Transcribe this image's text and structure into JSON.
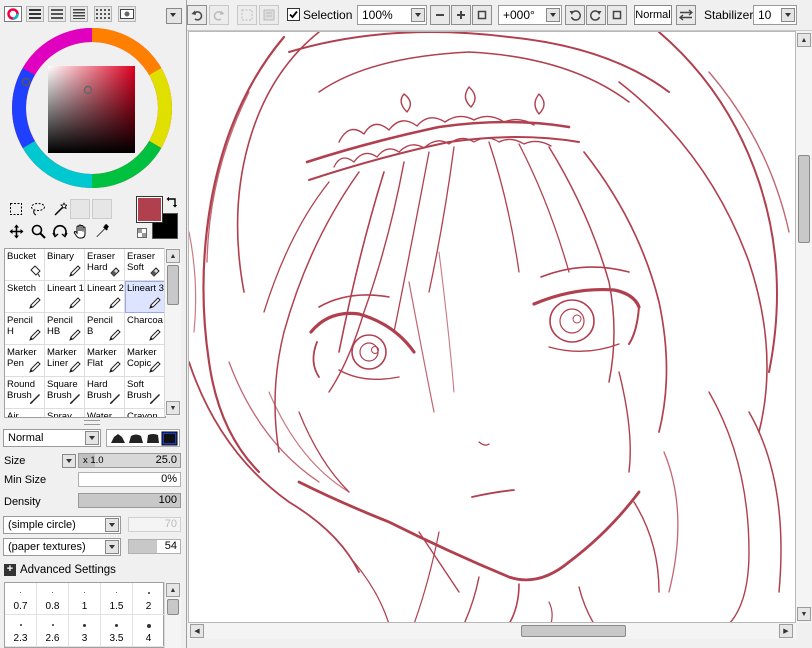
{
  "left_panel": {
    "color_mode_tabs": [
      "color-wheel-icon",
      "rgb-slider-icon",
      "hsv-slider-icon",
      "palette-icon",
      "swatch-icon",
      "scratch-pad-icon"
    ],
    "colors": {
      "primary": "#b0404d",
      "secondary": "#000000",
      "hue_ring_marker": "#d23c6a",
      "canvas_line": "#b1404f"
    },
    "tools": [
      "rectangle-select-icon",
      "lasso-icon",
      "magic-wand-icon",
      "move-icon",
      "zoom-icon",
      "rotate-icon",
      "hand-icon",
      "eyedropper-icon"
    ],
    "brushes": [
      [
        "Bucket",
        "Binary",
        "Eraser\nHard",
        "Eraser\nSoft"
      ],
      [
        "Sketch",
        "Lineart 1",
        "Lineart 2",
        "Lineart 3"
      ],
      [
        "Pencil\nH",
        "Pencil\nHB",
        "Pencil\nB",
        "Charcoa"
      ],
      [
        "Marker\nPen",
        "Marker\nLiner",
        "Marker\nFlat",
        "Marker\nCopic"
      ],
      [
        "Round\nBrush",
        "Square\nBrush",
        "Hard\nBrush",
        "Soft\nBrush"
      ],
      [
        "Air",
        "Spray",
        "Water",
        "Crayon"
      ]
    ],
    "blend_mode": "Normal",
    "size_label": "Size",
    "size_multiplier": "x 1.0",
    "size_value": "25.0",
    "min_size_label": "Min Size",
    "min_size_value": "0%",
    "density_label": "Density",
    "density_value": "100",
    "shape_select": "(simple circle)",
    "shape_value": "70",
    "texture_select": "(paper textures)",
    "texture_value": "54",
    "advanced_label": "Advanced Settings",
    "size_presets_row1": [
      "0.7",
      "0.8",
      "1",
      "1.5",
      "2"
    ],
    "size_presets_row2": [
      "2.3",
      "2.6",
      "3",
      "3.5",
      "4"
    ]
  },
  "toolbar": {
    "selection_label": "Selection",
    "selection_checked": true,
    "zoom_value": "100%",
    "rotation_value": "+000°",
    "blend_label": "Normal",
    "stabilizer_label": "Stabilizer",
    "stabilizer_value": "10"
  }
}
